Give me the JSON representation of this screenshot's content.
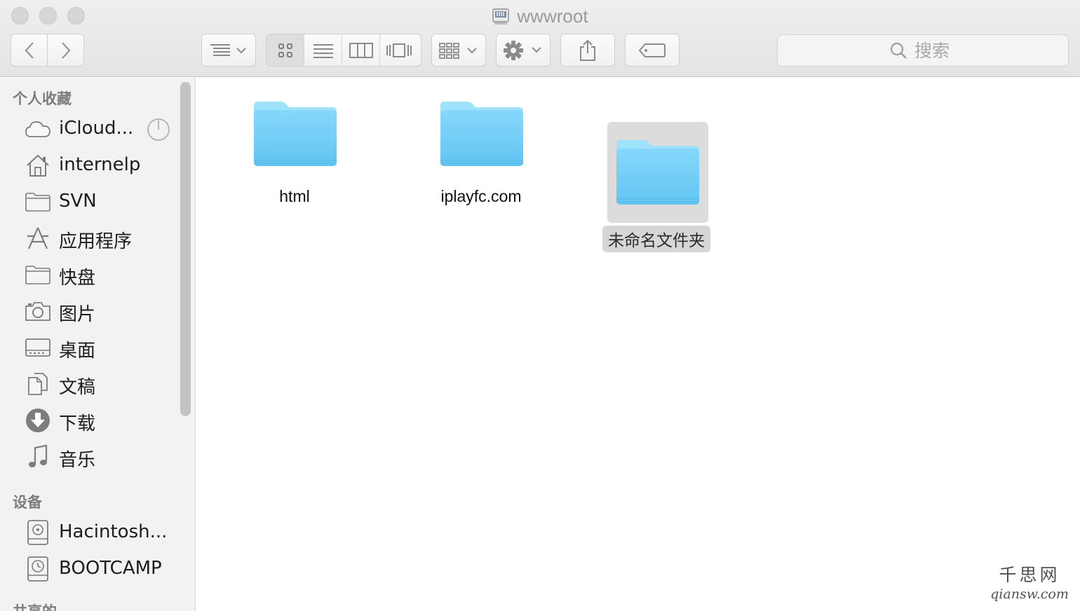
{
  "window": {
    "title": "wwwroot"
  },
  "toolbar": {
    "back_icon": "chevron-left-icon",
    "forward_icon": "chevron-right-icon",
    "arrange_icon": "list-arrange-icon",
    "view_modes": [
      "icon-view-icon",
      "list-view-icon",
      "column-view-icon",
      "cover-flow-icon"
    ],
    "active_view": "icon-view-icon",
    "group_icon": "group-grid-icon",
    "action_icon": "gear-icon",
    "share_icon": "share-icon",
    "tag_icon": "tag-icon"
  },
  "search": {
    "placeholder": "搜索"
  },
  "sidebar": {
    "favorites_title": "个人收藏",
    "favorites": [
      {
        "label": "iCloud...",
        "icon": "cloud-icon"
      },
      {
        "label": "internelp",
        "icon": "home-icon"
      },
      {
        "label": "SVN",
        "icon": "folder-icon"
      },
      {
        "label": "应用程序",
        "icon": "applications-icon"
      },
      {
        "label": "快盘",
        "icon": "folder-icon"
      },
      {
        "label": "图片",
        "icon": "camera-icon"
      },
      {
        "label": "桌面",
        "icon": "desktop-icon"
      },
      {
        "label": "文稿",
        "icon": "documents-icon"
      },
      {
        "label": "下载",
        "icon": "download-icon"
      },
      {
        "label": "音乐",
        "icon": "music-note-icon"
      }
    ],
    "devices_title": "设备",
    "devices": [
      {
        "label": "Hacintosh...",
        "icon": "hard-drive-icon"
      },
      {
        "label": "BOOTCAMP",
        "icon": "time-machine-drive-icon"
      }
    ],
    "shared_title": "共享的"
  },
  "files": [
    {
      "name": "html",
      "selected": false
    },
    {
      "name": "iplayfc.com",
      "selected": false
    },
    {
      "name": "未命名文件夹",
      "selected": true
    }
  ],
  "watermark": {
    "line1": "千思网",
    "line2": "qiansw.com"
  },
  "colors": {
    "folder_top": "#8fdcfa",
    "folder_body": "#6cc9f4",
    "selection": "#dcdcdc"
  }
}
